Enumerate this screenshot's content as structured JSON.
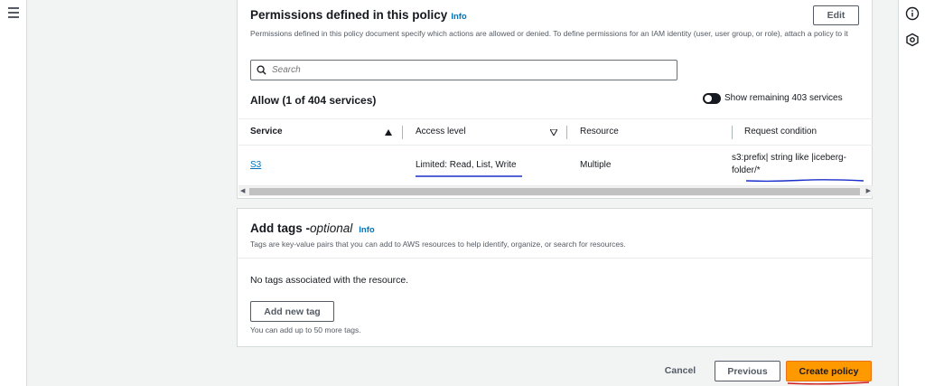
{
  "permissions": {
    "title": "Permissions defined in this policy",
    "info": "Info",
    "edit_label": "Edit",
    "description": "Permissions defined in this policy document specify which actions are allowed or denied. To define permissions for an IAM identity (user, user group, or role), attach a policy to it",
    "search_placeholder": "Search",
    "allow_heading": "Allow (1 of 404 services)",
    "show_remaining_label": "Show remaining 403 services",
    "columns": [
      "Service",
      "Access level",
      "Resource",
      "Request condition"
    ],
    "rows": [
      {
        "service": "S3",
        "access_level": "Limited: Read, List, Write",
        "resource": "Multiple",
        "condition_line1": "s3:prefix| string like |iceberg-",
        "condition_line2": "folder/*"
      }
    ]
  },
  "tags": {
    "title": "Add tags - ",
    "title_optional": "optional",
    "info": "Info",
    "description": "Tags are key-value pairs that you can add to AWS resources to help identify, organize, or search for resources.",
    "empty_text": "No tags associated with the resource.",
    "add_label": "Add new tag",
    "limit_text": "You can add up to 50 more tags."
  },
  "footer": {
    "cancel_label": "Cancel",
    "previous_label": "Previous",
    "create_label": "Create policy"
  },
  "colors": {
    "primary": "#ff9900",
    "link": "#0073bb",
    "annotation": "#1a2fc9",
    "annotation_red": "#d11a1a"
  },
  "icons": [
    "menu-icon",
    "info-circle-icon",
    "settings-hex-icon",
    "search-icon",
    "sort-up-icon",
    "sort-down-icon"
  ]
}
